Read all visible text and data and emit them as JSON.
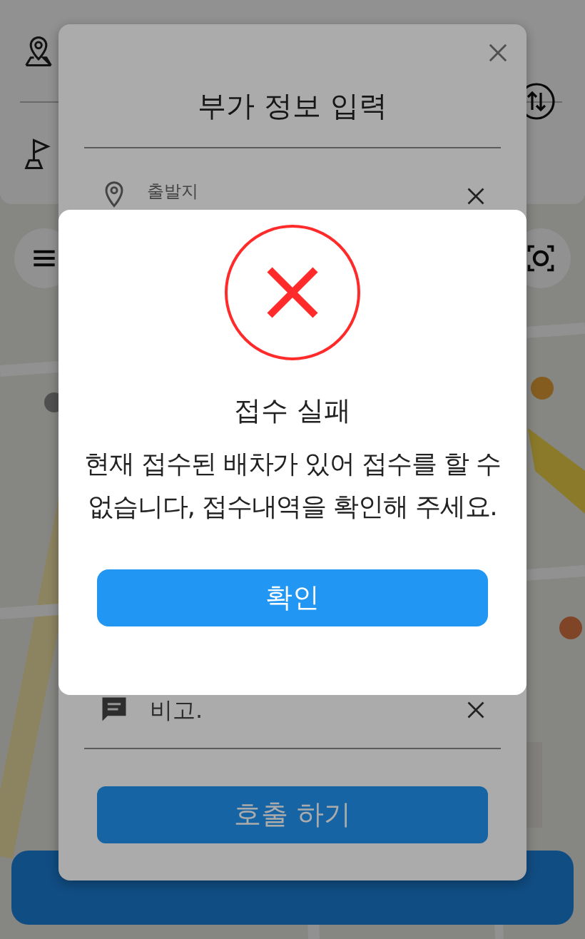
{
  "form_dialog": {
    "title": "부가 정보 입력",
    "origin_field": {
      "label": "출발지"
    },
    "memo_field": {
      "placeholder": "비고."
    },
    "submit_button": "호출 하기"
  },
  "alert": {
    "title": "접수 실패",
    "message": "현재 접수된 배차가 있어 접수를 할 수 없습니다, 접수내역을 확인해 주세요.",
    "confirm_button": "확인"
  }
}
